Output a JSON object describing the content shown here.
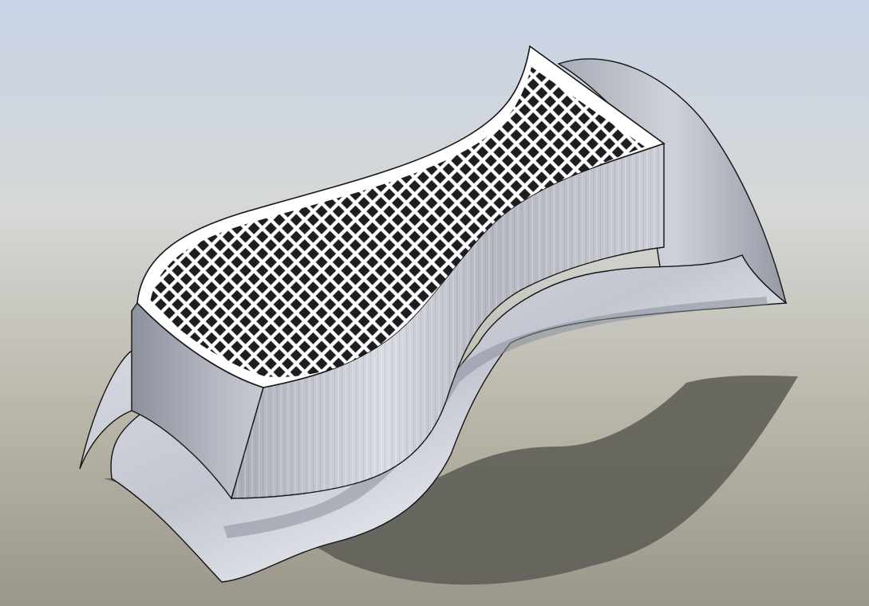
{
  "scene": {
    "subject": "cad-part-lattice-infill",
    "colors": {
      "background_top": "#c9d3e6",
      "background_bottom": "#9a968a",
      "shadow": "#5a5a55",
      "metal_light": "#e6e8ef",
      "metal_mid": "#b9bcc6",
      "metal_dark": "#7f838e",
      "lattice_frame": "#ffffff",
      "lattice_hole": "#1e1e22",
      "outline": "#141414"
    }
  }
}
